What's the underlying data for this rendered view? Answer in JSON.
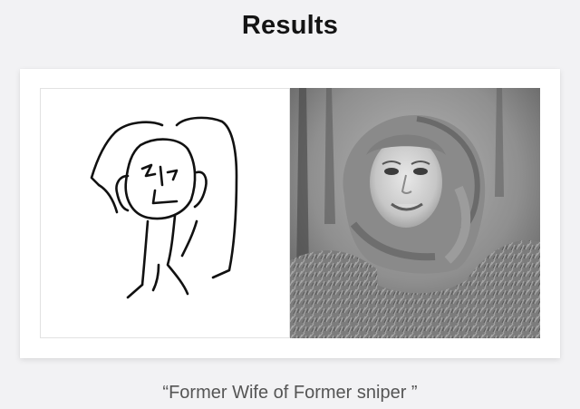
{
  "header": {
    "title": "Results"
  },
  "result": {
    "caption": "“Former Wife of Former sniper ”"
  }
}
